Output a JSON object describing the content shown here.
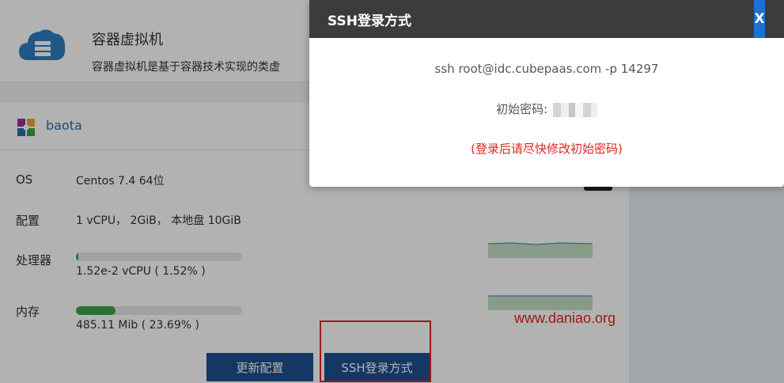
{
  "product": {
    "title": "容器虚拟机",
    "desc": "容器虚拟机是基于容器技术实现的类虚"
  },
  "vm": {
    "name": "baota",
    "os": {
      "label": "OS",
      "value": "Centos 7.4 64位"
    },
    "config": {
      "label": "配置",
      "value": "1 vCPU， 2GiB， 本地盘 10GiB"
    },
    "cpu": {
      "label": "处理器",
      "value": "1.52e-2 vCPU ( 1.52% )",
      "percent": 1.52
    },
    "memory": {
      "label": "内存",
      "value": "485.11 Mib ( 23.69% )",
      "percent": 23.69
    }
  },
  "buttons": {
    "update": "更新配置",
    "ssh": "SSH登录方式"
  },
  "watermark": "www.daniao.org",
  "modal": {
    "title": "SSH登录方式",
    "close": "X",
    "ssh_command": "ssh root@idc.cubepaas.com -p 14297",
    "password_label": "初始密码:",
    "warning": "(登录后请尽快修改初始密码)"
  },
  "colors": {
    "accent": "#1f4f8f",
    "progress": "#3aa34a",
    "warning": "#e02424",
    "modal_header": "#3c3c3c",
    "close_button": "#1e6fd9"
  }
}
